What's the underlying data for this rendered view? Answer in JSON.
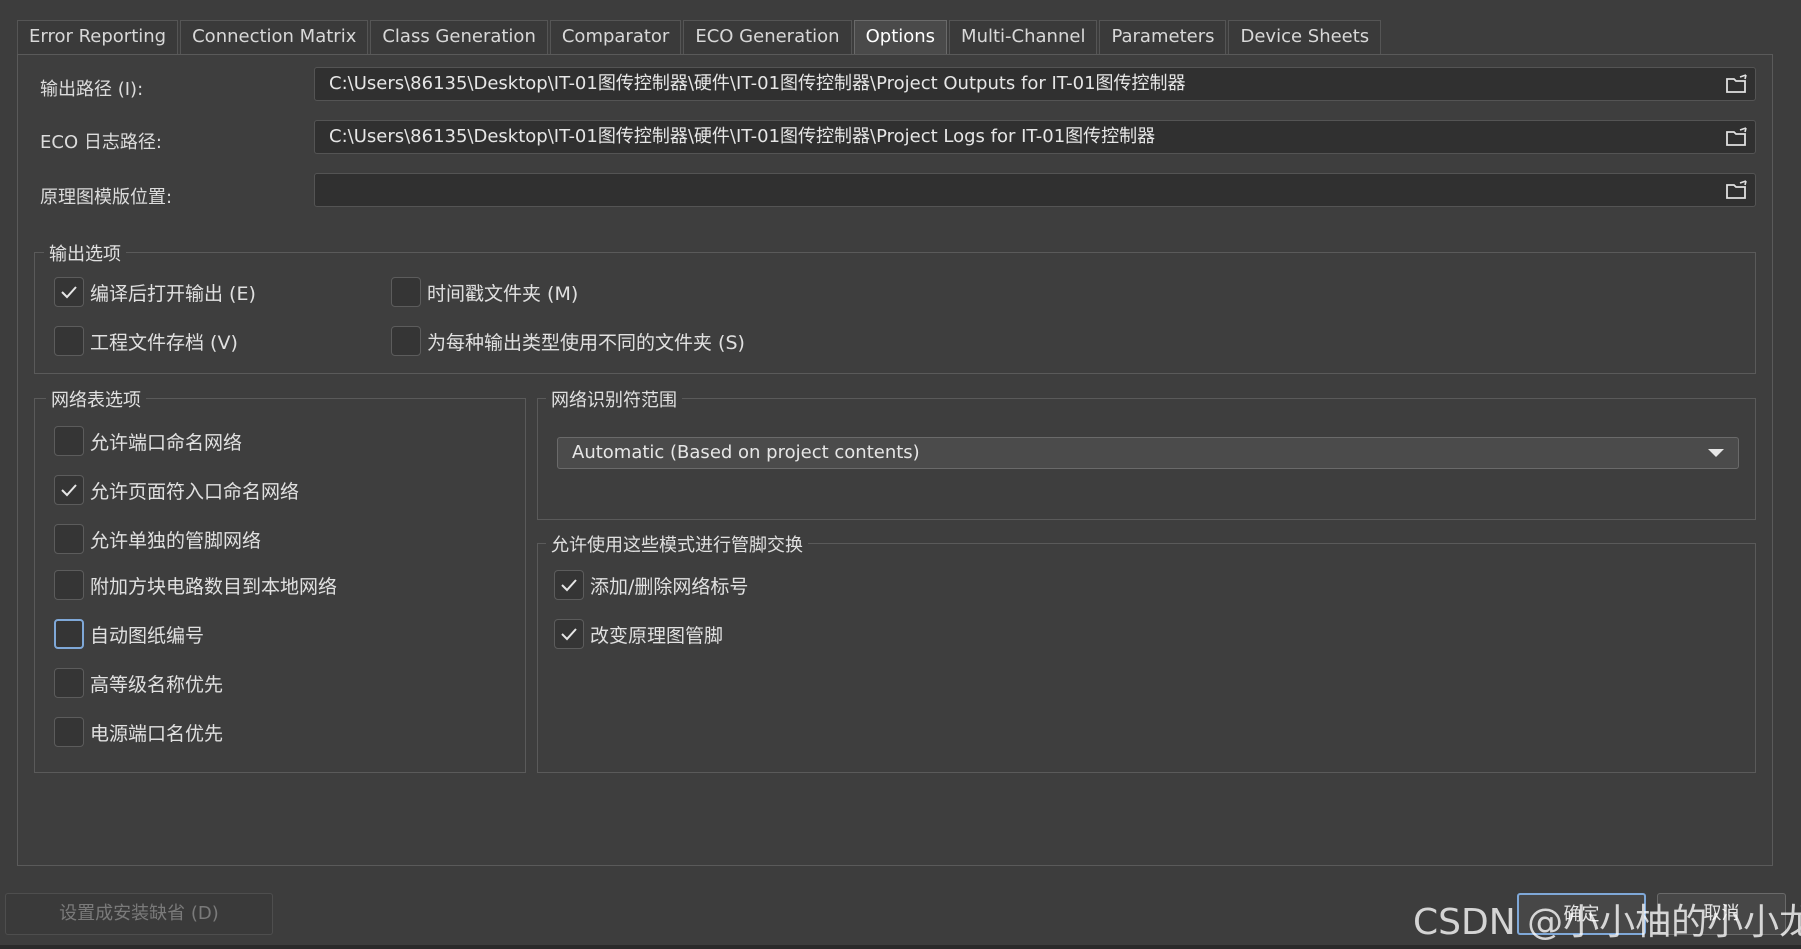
{
  "tabs": [
    {
      "label": "Error Reporting"
    },
    {
      "label": "Connection Matrix"
    },
    {
      "label": "Class Generation"
    },
    {
      "label": "Comparator"
    },
    {
      "label": "ECO Generation"
    },
    {
      "label": "Options",
      "active": true
    },
    {
      "label": "Multi-Channel"
    },
    {
      "label": "Parameters"
    },
    {
      "label": "Device Sheets"
    }
  ],
  "paths": {
    "output": {
      "label": "输出路径 (I):",
      "value": "C:\\Users\\86135\\Desktop\\IT-01图传控制器\\硬件\\IT-01图传控制器\\Project Outputs for IT-01图传控制器"
    },
    "eco_log": {
      "label": "ECO 日志路径:",
      "value": "C:\\Users\\86135\\Desktop\\IT-01图传控制器\\硬件\\IT-01图传控制器\\Project Logs for IT-01图传控制器"
    },
    "schematic_template": {
      "label": "原理图模版位置:",
      "value": ""
    }
  },
  "output_options": {
    "title": "输出选项",
    "open_after_compile": {
      "label": "编译后打开输出 (E)",
      "checked": true
    },
    "timestamp_folder": {
      "label": "时间戳文件夹 (M)",
      "checked": false
    },
    "archive_project": {
      "label": "工程文件存档 (V)",
      "checked": false
    },
    "separate_folders": {
      "label": "为每种输出类型使用不同的文件夹 (S)",
      "checked": false
    }
  },
  "netlist_options": {
    "title": "网络表选项",
    "items": [
      {
        "label": "允许端口命名网络",
        "checked": false
      },
      {
        "label": "允许页面符入口命名网络",
        "checked": true
      },
      {
        "label": "允许单独的管脚网络",
        "checked": false
      },
      {
        "label": "附加方块电路数目到本地网络",
        "checked": false
      },
      {
        "label": "自动图纸编号",
        "checked": false
      },
      {
        "label": "高等级名称优先",
        "checked": false
      },
      {
        "label": "电源端口名优先",
        "checked": false
      }
    ]
  },
  "net_identifier_scope": {
    "title": "网络识别符范围",
    "selected": "Automatic (Based on project contents)"
  },
  "pin_swap": {
    "title": "允许使用这些模式进行管脚交换",
    "items": [
      {
        "label": "添加/删除网络标号",
        "checked": true
      },
      {
        "label": "改变原理图管脚",
        "checked": true
      }
    ]
  },
  "buttons": {
    "set_default": "设置成安装缺省 (D)",
    "ok": "确定",
    "cancel": "取消"
  },
  "watermark": "CSDN @小小柚的小小龙",
  "icons": {
    "folder": "open-folder-icon",
    "check": "checkmark-icon",
    "caret": "chevron-down-icon"
  },
  "colors": {
    "background": "#3d3d3d",
    "focus_border": "#7fa8d8",
    "text": "#dcdcdc"
  }
}
